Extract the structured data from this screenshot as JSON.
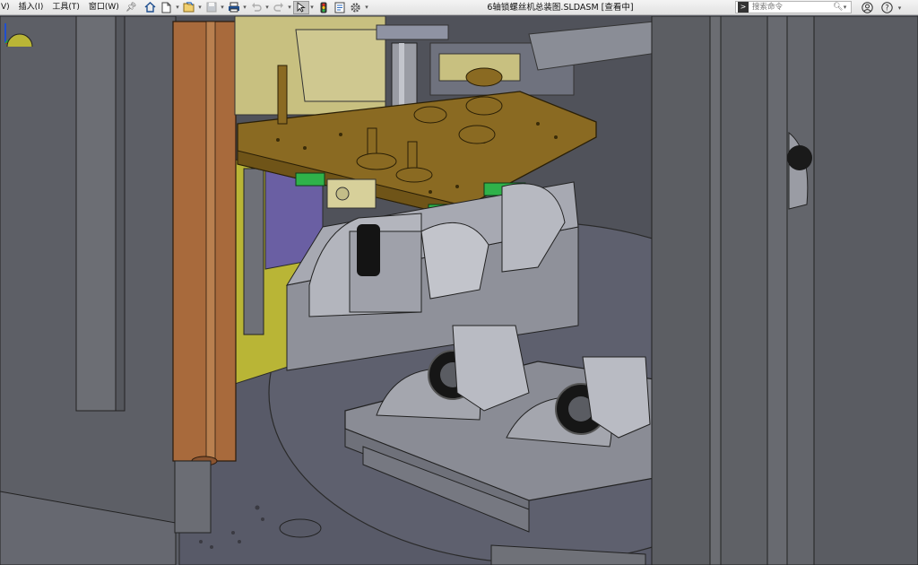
{
  "menu": {
    "items": [
      {
        "label": "V)"
      },
      {
        "label": "插入(I)"
      },
      {
        "label": "工具(T)"
      },
      {
        "label": "窗口(W)"
      }
    ]
  },
  "document": {
    "title": "6轴锁螺丝机总装图.SLDASM [查看中]"
  },
  "search": {
    "placeholder": "搜索命令"
  },
  "toolbar": {
    "icons": [
      "home-icon",
      "new-document-icon",
      "open-folder-icon",
      "save-icon",
      "print-icon",
      "undo-icon",
      "redo-icon",
      "select-arrow-icon",
      "traffic-light-icon",
      "file-properties-icon",
      "options-gear-icon"
    ]
  },
  "colors": {
    "toolbar_bg": "#e8e8e8",
    "viewport_bg": "#5b5d66",
    "bronze_plate": "#8a6a22",
    "copper_column": "#a86a3c",
    "yellow_panel": "#b9b536",
    "green_block": "#2fb24a",
    "purple_panel": "#6a5fa3"
  }
}
